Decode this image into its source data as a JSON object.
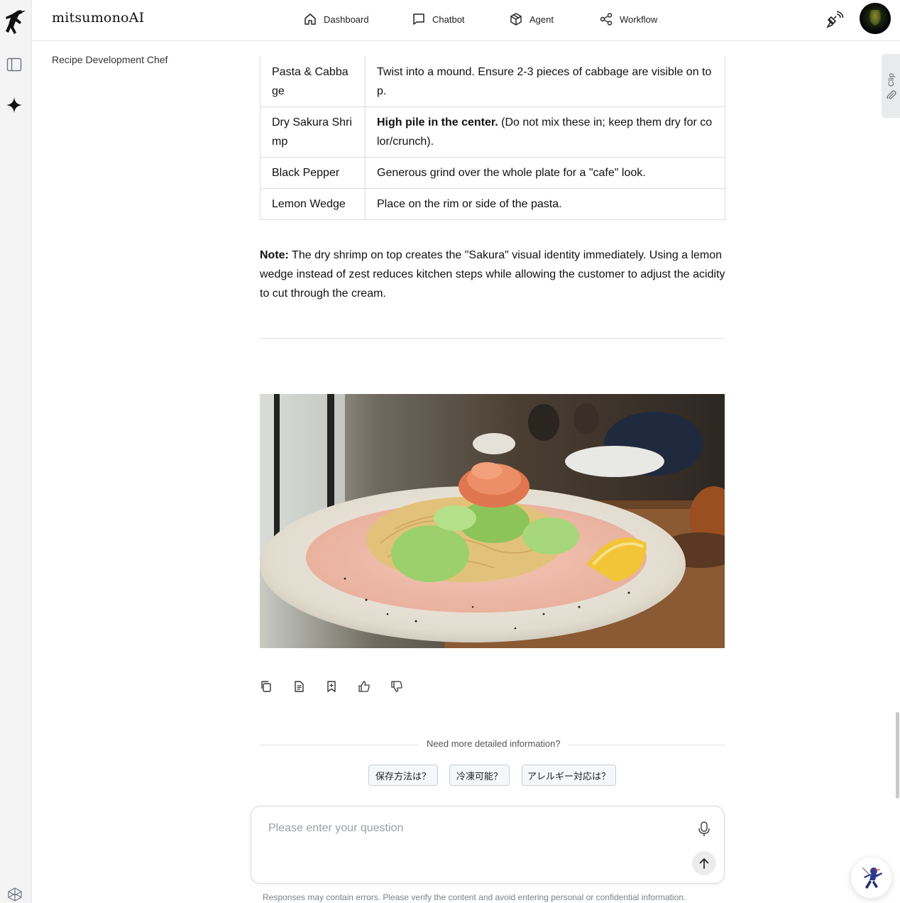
{
  "app": {
    "brand": "mitsumonoAI",
    "page_title": "Recipe Development Chef"
  },
  "nav": [
    {
      "label": "Dashboard",
      "icon": "home-icon"
    },
    {
      "label": "Chatbot",
      "icon": "chat-bubble-icon"
    },
    {
      "label": "Agent",
      "icon": "cube-icon"
    },
    {
      "label": "Workflow",
      "icon": "share-nodes-icon"
    }
  ],
  "table": {
    "rows": [
      {
        "item": "Pasta & Cabbage",
        "instruction_bold": "",
        "instruction": "Twist into a mound. Ensure 2-3 pieces of cabbage are visible on top."
      },
      {
        "item": "Dry Sakura Shrimp",
        "instruction_bold": "High pile in the center.",
        "instruction": " (Do not mix these in; keep them dry for color/crunch)."
      },
      {
        "item": "Black Pepper",
        "instruction_bold": "",
        "instruction": "Generous grind over the whole plate for a \"cafe\" look."
      },
      {
        "item": "Lemon Wedge",
        "instruction_bold": "",
        "instruction": "Place on the rim or side of the pasta."
      }
    ]
  },
  "note": {
    "label": "Note:",
    "text": " The dry shrimp on top creates the \"Sakura\" visual identity immediately. Using a lemon wedge instead of zest reduces kitchen steps while allowing the customer to adjust the acidity to cut through the cream."
  },
  "actions": [
    "copy-icon",
    "document-icon",
    "bookmark-icon",
    "thumbs-up-icon",
    "thumbs-down-icon"
  ],
  "followup": {
    "prompt": "Need more detailed information?",
    "chips": [
      "保存方法は？",
      "冷凍可能？",
      "アレルギー対応は？"
    ]
  },
  "input": {
    "placeholder": "Please enter your question"
  },
  "disclaimer": "Responses may contain errors. Please verify the content and avoid entering personal or confidential information.",
  "clip_tab": "Clip",
  "colors": {
    "rail_bg": "#f4f4f5",
    "chip_bg": "#f5f7fa",
    "chip_border": "#c9ced6"
  }
}
